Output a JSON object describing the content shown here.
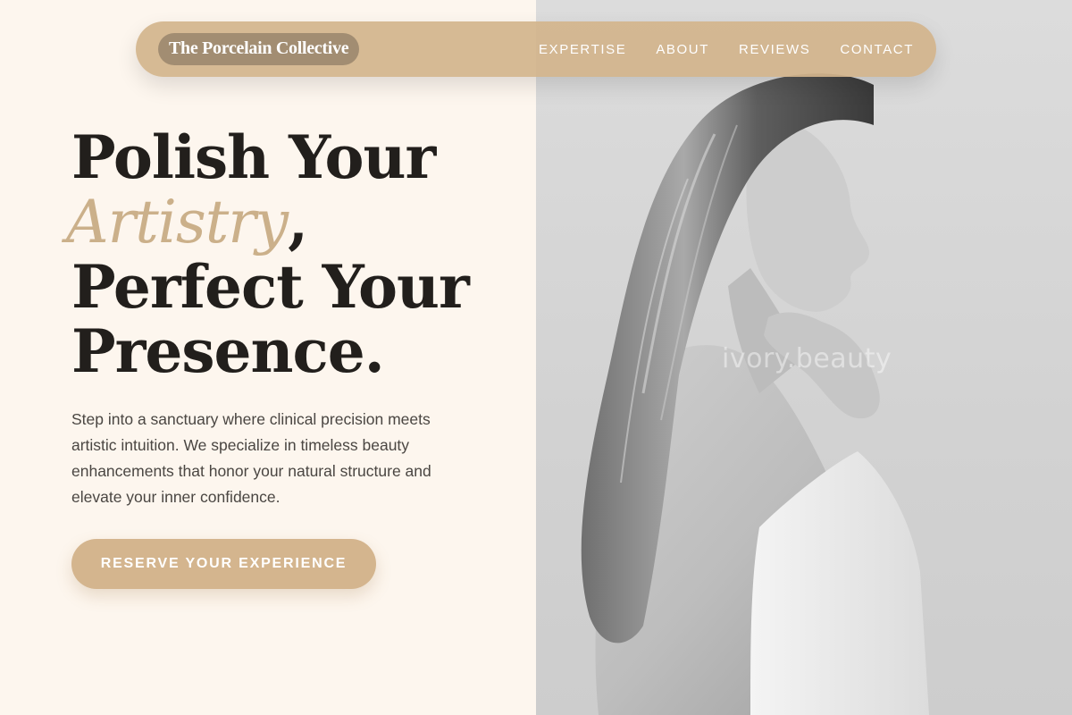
{
  "nav": {
    "brand": "The Porcelain Collective",
    "links": [
      "EXPERTISE",
      "ABOUT",
      "REVIEWS",
      "CONTACT"
    ]
  },
  "hero": {
    "title_line1": "Polish Your",
    "title_accent": "Artistry",
    "title_comma": ",",
    "title_line3": "Perfect Your",
    "title_line4": "Presence.",
    "description": "Step into a sanctuary where clinical precision meets artistic intuition. We specialize in timeless beauty enhancements that honor your natural structure and elevate your inner confidence.",
    "cta_label": "RESERVE YOUR EXPERIENCE",
    "image_watermark": "ivory.beauty"
  },
  "colors": {
    "page_bg": "#fdf6ee",
    "accent": "#d4b58e",
    "heading": "#221f1c",
    "body_text": "#4a4642"
  }
}
